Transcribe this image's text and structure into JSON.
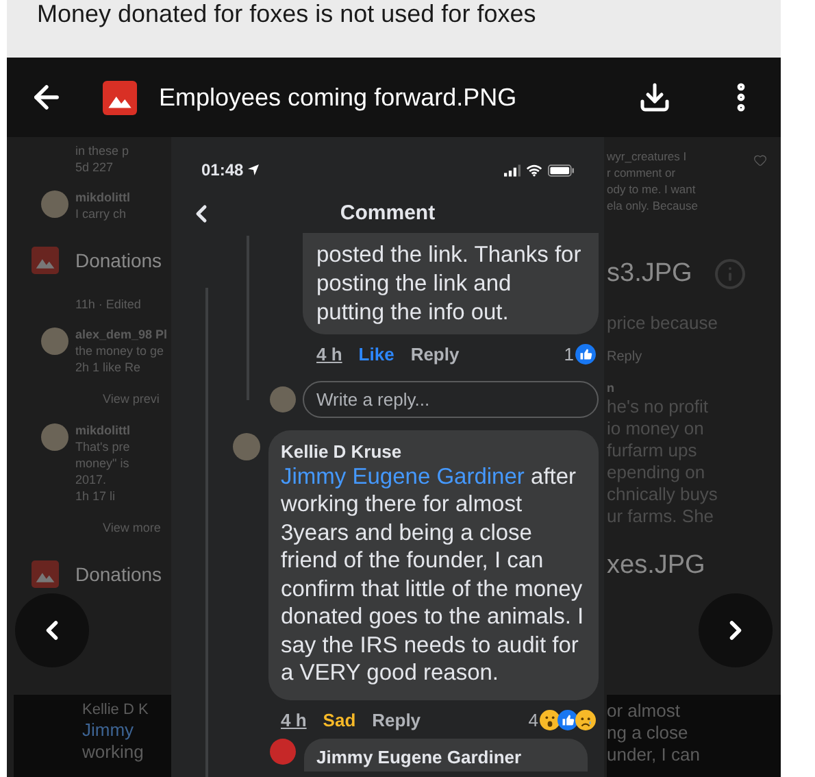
{
  "page": {
    "title": "Money donated for foxes is not used for foxes"
  },
  "viewer": {
    "file_name": "Employees coming forward.PNG"
  },
  "background": {
    "left": [
      {
        "kind": "snippet",
        "lines": [
          "in these p",
          "5d 227"
        ]
      },
      {
        "kind": "user_snippet",
        "lines": [
          "mikdolittl",
          "I carry ch"
        ]
      },
      {
        "kind": "file",
        "name": "Donations"
      },
      {
        "kind": "snippet",
        "lines": [
          "11h · Edited"
        ]
      },
      {
        "kind": "user_snippet",
        "lines": [
          "alex_dem_98 Pl",
          "the money to ge",
          "2h 1 like Re"
        ]
      },
      {
        "kind": "link",
        "text": "View previ"
      },
      {
        "kind": "user_snippet",
        "lines": [
          "mikdolittl",
          "That's pre",
          "money\" is",
          "2017.",
          "1h 17 li"
        ]
      },
      {
        "kind": "link",
        "text": "View more"
      },
      {
        "kind": "file",
        "name": "Donations"
      },
      {
        "kind": "screenshot",
        "author": "Kellie D K",
        "mention": "Jimmy",
        "lines": [
          "working"
        ]
      }
    ],
    "right": [
      {
        "kind": "comment",
        "lines": [
          "wyr_creatures I",
          "r comment or",
          "ody to me. I want",
          "ela only. Because"
        ]
      },
      {
        "kind": "file_info",
        "name": "s3.JPG"
      },
      {
        "kind": "bubble",
        "lines": [
          "price because"
        ]
      },
      {
        "kind": "link",
        "text": "Reply"
      },
      {
        "kind": "bubble",
        "author": "n",
        "lines": [
          "he's no profit",
          "io money on",
          "furfarm ups",
          "epending on",
          "chnically buys",
          "ur farms. She"
        ]
      },
      {
        "kind": "file_plain",
        "name": "xes.JPG"
      },
      {
        "kind": "screenshot",
        "lines": [
          "or almost",
          "ng a close",
          "under, I can"
        ]
      }
    ]
  },
  "phone": {
    "time": "01:48",
    "nav_title": "Comment",
    "reply": {
      "text": "posted the link. Thanks for posting the link and putting the info out.",
      "time": "4 h",
      "reaction": {
        "kind": "like",
        "label": "Like"
      },
      "action": "Reply",
      "count": "1"
    },
    "reply_field": {
      "placeholder": "Write a reply..."
    },
    "comment": {
      "author": "Kellie D Kruse",
      "mention": "Jimmy Eugene Gardiner",
      "text": "after working there for almost 3years and being a close friend of the founder, I can confirm that little of the money donated goes to the animals. I say the IRS needs to audit for a VERY good reason.",
      "time": "4 h",
      "reaction": {
        "kind": "sad",
        "label": "Sad"
      },
      "action": "Reply",
      "count": "4"
    },
    "next_author": "Jimmy Eugene Gardiner"
  }
}
